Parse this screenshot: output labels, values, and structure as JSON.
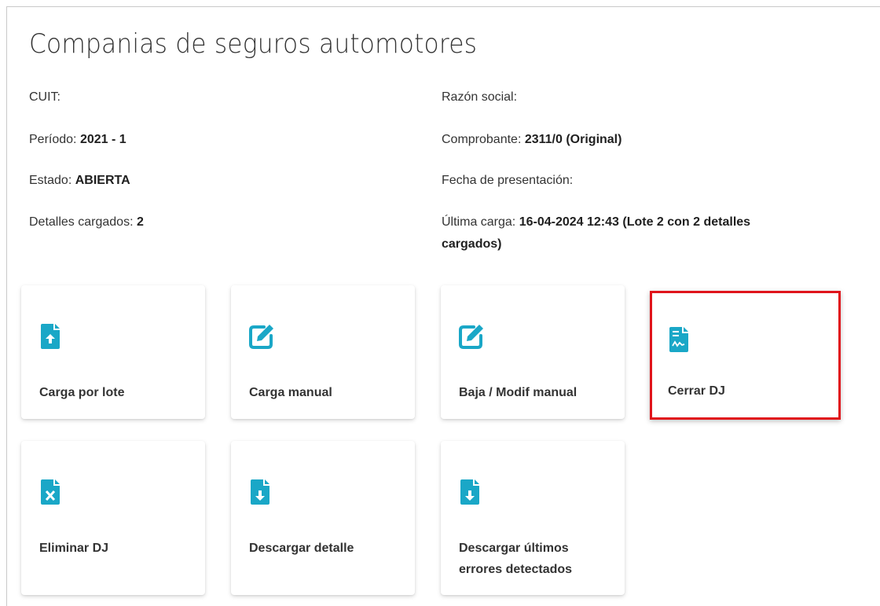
{
  "page": {
    "title": "Companias de seguros automotores"
  },
  "info": {
    "cuit_label": "CUIT:",
    "razon_label": "Razón social:",
    "periodo_label": "Período:",
    "periodo_value": "2021 - 1",
    "comprobante_label": "Comprobante:",
    "comprobante_value": "2311/0 (Original)",
    "estado_label": "Estado:",
    "estado_value": "ABIERTA",
    "fecha_label": "Fecha de presentación:",
    "detalles_label": "Detalles cargados:",
    "detalles_value": "2",
    "ultima_label": "Última carga:",
    "ultima_value": "16-04-2024 12:43 (Lote 2 con 2 detalles cargados)"
  },
  "cards": [
    {
      "label": "Carga por lote",
      "icon": "file-upload-icon"
    },
    {
      "label": "Carga manual",
      "icon": "edit-icon"
    },
    {
      "label": "Baja / Modif manual",
      "icon": "edit-icon"
    },
    {
      "label": "Cerrar DJ",
      "icon": "file-signature-icon",
      "highlighted": true
    },
    {
      "label": "Eliminar DJ",
      "icon": "file-delete-icon"
    },
    {
      "label": "Descargar detalle",
      "icon": "file-download-icon"
    },
    {
      "label": "Descargar últimos errores detectados",
      "icon": "file-download-icon"
    }
  ],
  "colors": {
    "icon_accent": "#1AA7C7",
    "highlight_border": "#E0141B"
  }
}
